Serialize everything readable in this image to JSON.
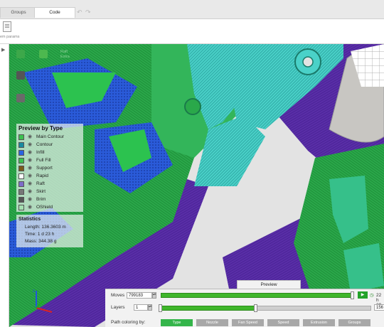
{
  "tabs": [
    {
      "label": "Groups"
    },
    {
      "label": "Code"
    }
  ],
  "ribbon": {
    "params_label": "em params"
  },
  "legend": {
    "title": "Preview by Type",
    "items": [
      {
        "label": "Main Contour",
        "color": "#3cc050"
      },
      {
        "label": "Contour",
        "color": "#1a8aa0"
      },
      {
        "label": "Infill",
        "color": "#2a63e0"
      },
      {
        "label": "Full Fill",
        "color": "#3cc050"
      },
      {
        "label": "Support",
        "color": "#7a5a1a"
      },
      {
        "label": "Rapid",
        "color": "#ffffff"
      },
      {
        "label": "Raft",
        "color": "#7d6cc9"
      },
      {
        "label": "Skirt",
        "color": "#777777"
      },
      {
        "label": "Brim",
        "color": "#555555"
      },
      {
        "label": "OShield",
        "color": "#a5dfb0"
      }
    ]
  },
  "stats": {
    "title": "Statistics",
    "length": "Length: 136.3603 m",
    "time": "Time: 1 d 23 h",
    "mass": "Mass: 344.38 g"
  },
  "viewport_labels": {
    "line1": "Raft",
    "line2": "Extra"
  },
  "preview": {
    "tab_label": "Preview",
    "moves_label": "Moves",
    "moves_value": "799183",
    "moves_fraction": 1.0,
    "time_label": "22 h 29",
    "layers_label": "Layers",
    "layers_start": "1",
    "layers_end": "156",
    "layers_fraction": 0.45,
    "coloring_label": "Path coloring by:",
    "buttons": [
      {
        "label": "Type",
        "active": true
      },
      {
        "label": "Nozzle",
        "active": false
      },
      {
        "label": "Fan Speed",
        "active": false
      },
      {
        "label": "Speed",
        "active": false
      },
      {
        "label": "Extrusion",
        "active": false
      },
      {
        "label": "Groups",
        "active": false
      }
    ]
  },
  "colors": {
    "model_green": "#2cb24a",
    "raft_purple": "#5a2ea8",
    "contour_teal": "#3ec9c4",
    "infill_blue": "#2a5bd9",
    "background_gray": "#e3e3e3"
  }
}
